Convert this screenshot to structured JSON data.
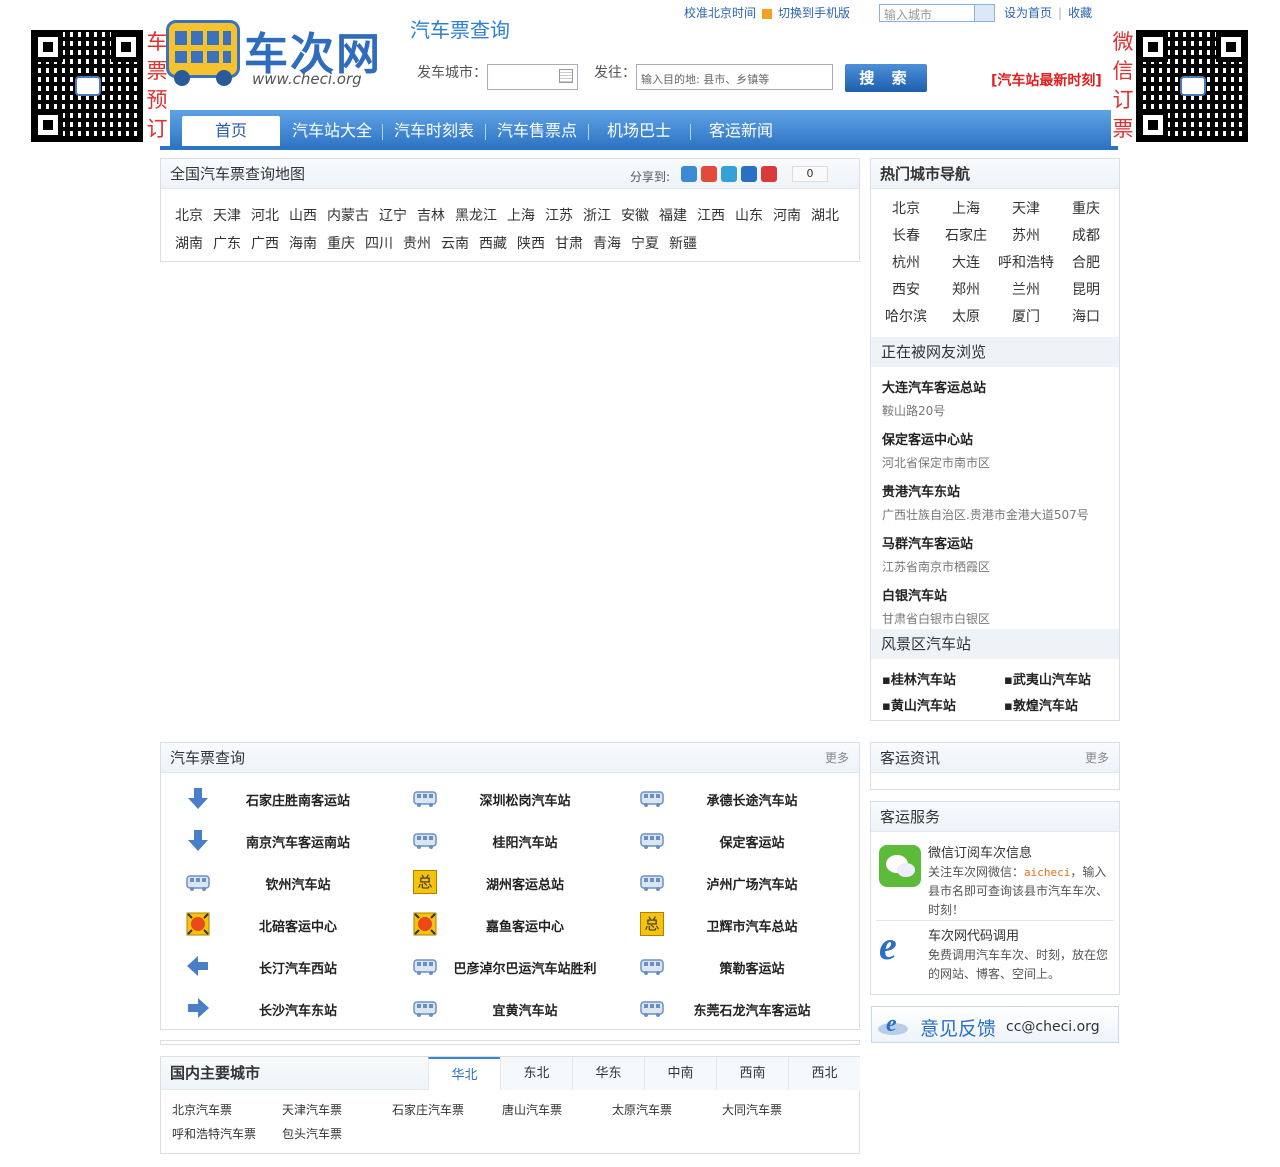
{
  "header": {
    "left_vertical": "车票预订",
    "right_vertical": "微信订票",
    "logo_name": "车次网",
    "logo_url": "www.checi.org",
    "subtitle": "汽车票查询",
    "top_links": [
      "校准北京时间",
      "切换到手机版"
    ],
    "top_search_placeholder": "输入城市",
    "top_links_right": [
      "设为首页",
      "收藏"
    ],
    "from_label": "发车城市：",
    "to_label": "发往：",
    "to_placeholder": "输入目的地: 县市、乡镇等",
    "search_button": "搜 索",
    "latest_link": "[汽车站最新时刻]"
  },
  "nav": [
    "首页",
    "汽车站大全",
    "汽车时刻表",
    "汽车售票点",
    "机场巴士",
    "客运新闻"
  ],
  "map_box": {
    "title": "全国汽车票查询地图",
    "share_label": "分享到:",
    "share_count": "0",
    "provinces_row1": [
      "北京",
      "天津",
      "河北",
      "山西",
      "内蒙古",
      "辽宁",
      "吉林",
      "黑龙江",
      "上海",
      "江苏",
      "浙江",
      "安徽",
      "福建",
      "江西",
      "山东",
      "河南",
      "湖北"
    ],
    "provinces_row2": [
      "湖南",
      "广东",
      "广西",
      "海南",
      "重庆",
      "四川",
      "贵州",
      "云南",
      "西藏",
      "陕西",
      "甘肃",
      "青海",
      "宁夏",
      "新疆"
    ]
  },
  "hot_cities": {
    "title": "热门城市导航",
    "cities": [
      "北京",
      "上海",
      "天津",
      "重庆",
      "长春",
      "石家庄",
      "苏州",
      "成都",
      "杭州",
      "大连",
      "呼和浩特",
      "合肥",
      "西安",
      "郑州",
      "兰州",
      "昆明",
      "哈尔滨",
      "太原",
      "厦门",
      "海口"
    ]
  },
  "browsing": {
    "title": "正在被网友浏览",
    "items": [
      {
        "name": "大连汽车客运总站",
        "addr": "鞍山路20号"
      },
      {
        "name": "保定客运中心站",
        "addr": "河北省保定市南市区"
      },
      {
        "name": "贵港汽车东站",
        "addr": "广西壮族自治区.贵港市金港大道507号"
      },
      {
        "name": "马群汽车客运站",
        "addr": "江苏省南京市栖霞区"
      },
      {
        "name": "白银汽车站",
        "addr": "甘肃省白银市白银区"
      }
    ]
  },
  "scenic": {
    "title": "风景区汽车站",
    "items": [
      "桂林汽车站",
      "武夷山汽车站",
      "黄山汽车站",
      "敦煌汽车站"
    ]
  },
  "ticket_query": {
    "title": "汽车票查询",
    "more": "更多",
    "rows": [
      [
        {
          "icon": "arrow-down-icon",
          "name": "石家庄胜南客运站"
        },
        {
          "icon": "bus-icon",
          "name": "深圳松岗汽车站"
        },
        {
          "icon": "bus-icon",
          "name": "承德长途汽车站"
        }
      ],
      [
        {
          "icon": "arrow-down-icon",
          "name": "南京汽车客运南站"
        },
        {
          "icon": "bus-icon",
          "name": "桂阳汽车站"
        },
        {
          "icon": "bus-icon",
          "name": "保定客运站"
        }
      ],
      [
        {
          "icon": "bus-icon",
          "name": "钦州汽车站"
        },
        {
          "icon": "zong-icon",
          "name": "湖州客运总站"
        },
        {
          "icon": "bus-icon",
          "name": "泸州广场汽车站"
        }
      ],
      [
        {
          "icon": "center-icon",
          "name": "北碚客运中心"
        },
        {
          "icon": "center-icon",
          "name": "嘉鱼客运中心"
        },
        {
          "icon": "zong-icon",
          "name": "卫辉市汽车总站"
        }
      ],
      [
        {
          "icon": "arrow-left-icon",
          "name": "长汀汽车西站"
        },
        {
          "icon": "bus-icon",
          "name": "巴彦淖尔巴运汽车站胜利"
        },
        {
          "icon": "bus-icon",
          "name": "策勒客运站"
        }
      ],
      [
        {
          "icon": "arrow-right-icon",
          "name": "长沙汽车东站"
        },
        {
          "icon": "bus-icon",
          "name": "宜黄汽车站"
        },
        {
          "icon": "bus-icon",
          "name": "东莞石龙汽车客运站"
        }
      ]
    ],
    "zong_char": "总"
  },
  "news": {
    "title": "客运资讯",
    "more": "更多"
  },
  "service": {
    "title": "客运服务",
    "wechat_title": "微信订阅车次信息",
    "wechat_desc_pre": "关注车次网微信：",
    "wechat_id": "aicheci",
    "wechat_desc_post": "，输入县市名即可查询该县市汽车车次、时刻！",
    "code_title": "车次网代码调用",
    "code_desc": "免费调用汽车车次、时刻，放在您的网站、博客、空间上。"
  },
  "feedback": {
    "label": "意见反馈",
    "email": "cc@checi.org"
  },
  "major_cities": {
    "title": "国内主要城市",
    "tabs": [
      "华北",
      "东北",
      "华东",
      "中南",
      "西南",
      "西北"
    ],
    "active_tab": "华北",
    "cities": [
      "北京汽车票",
      "天津汽车票",
      "石家庄汽车票",
      "唐山汽车票",
      "太原汽车票",
      "大同汽车票",
      "呼和浩特汽车票",
      "包头汽车票"
    ]
  },
  "colors": {
    "brand_blue": "#2f6cbd",
    "nav_blue": "#2e74c4",
    "accent_red": "#e02020"
  }
}
